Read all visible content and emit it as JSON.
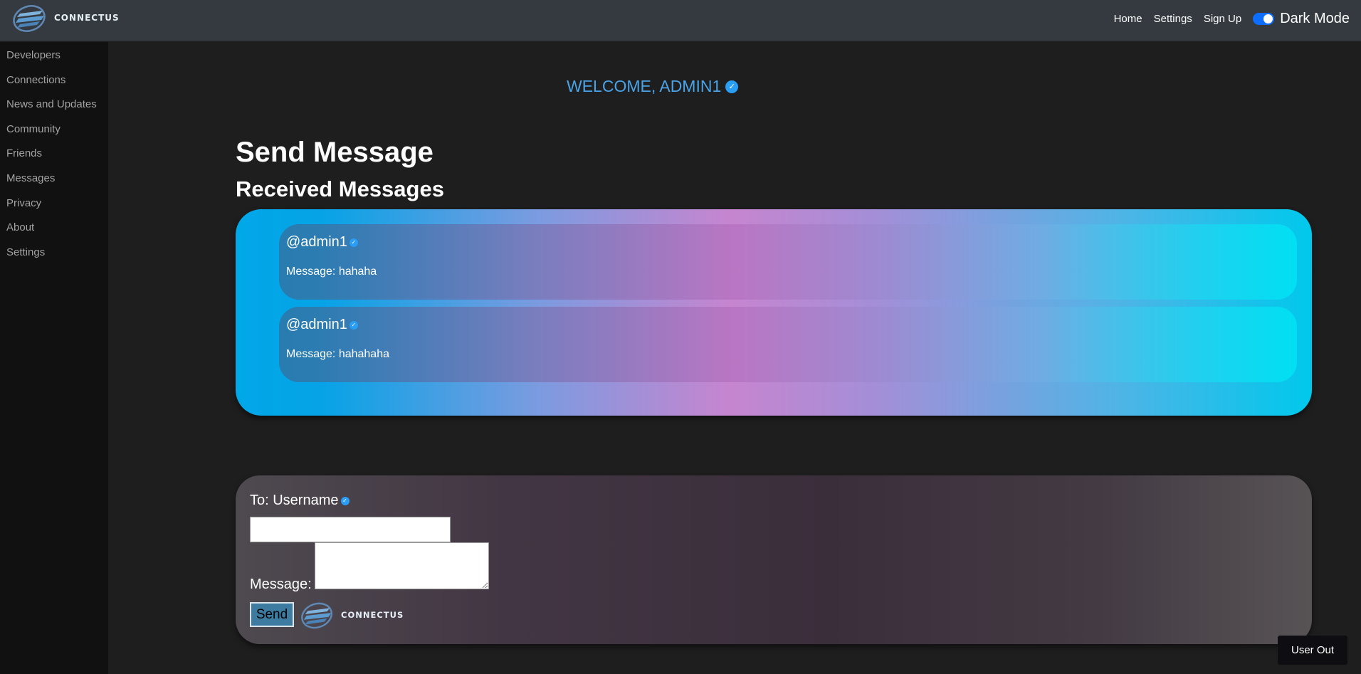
{
  "brand": {
    "name": "CONNECTUS",
    "logo_icon": "connectus-globe-logo"
  },
  "navbar": {
    "links": [
      "Home",
      "Settings",
      "Sign Up"
    ],
    "dark_mode_label": "Dark Mode",
    "dark_mode_enabled": true
  },
  "sidebar": {
    "items": [
      {
        "label": "Developers"
      },
      {
        "label": "Connections"
      },
      {
        "label": "News and Updates"
      },
      {
        "label": "Community"
      },
      {
        "label": "Friends"
      },
      {
        "label": "Messages"
      },
      {
        "label": "Privacy"
      },
      {
        "label": "About"
      },
      {
        "label": "Settings"
      }
    ]
  },
  "main": {
    "welcome": "WELCOME, ADMIN1",
    "send_heading": "Send Message",
    "received_heading": "Received Messages",
    "messages": [
      {
        "user": "@admin1",
        "text": "Message: hahaha"
      },
      {
        "user": "@admin1",
        "text": "Message: hahahaha"
      }
    ],
    "form": {
      "to_label": "To: Username",
      "to_value": "",
      "message_label": "Message:",
      "message_value": "",
      "send_label": "Send"
    }
  },
  "user_out_label": "User Out",
  "colors": {
    "navbar": "#343a40",
    "sidebar": "#111111",
    "background": "#1e1e1e",
    "accent": "#4aa3e6",
    "verified_badge": "#2a9df4"
  }
}
